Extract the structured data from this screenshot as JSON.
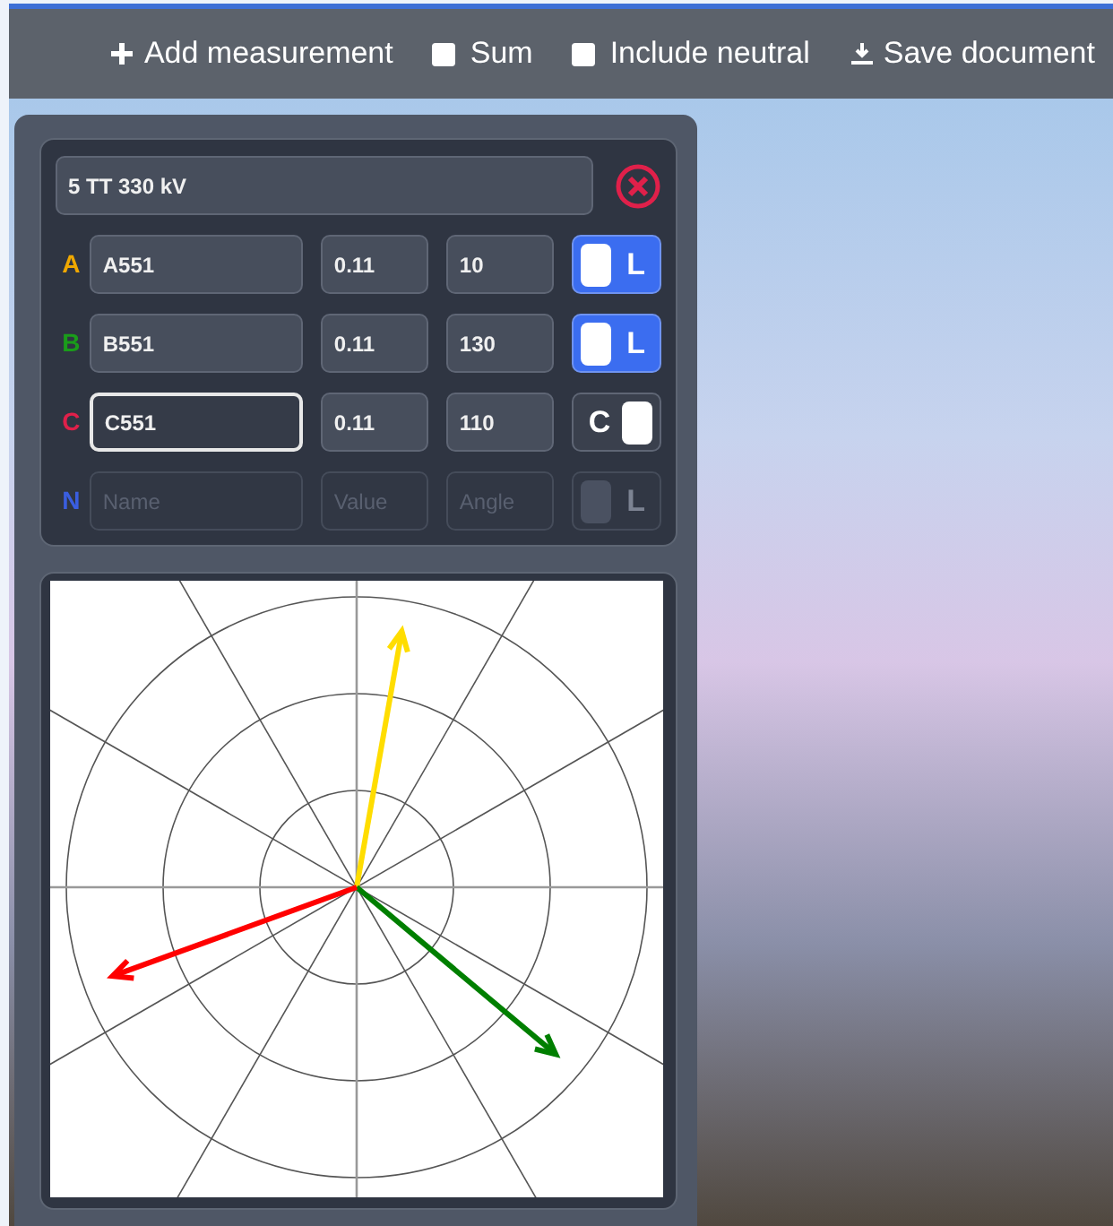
{
  "toolbar": [
    {
      "kind": "add",
      "label": "Add measurement"
    },
    {
      "kind": "checkbox",
      "label": "Sum",
      "checked": false
    },
    {
      "kind": "checkbox",
      "label": "Include neutral",
      "checked": false
    },
    {
      "kind": "save",
      "label": "Save document"
    }
  ],
  "measurement": {
    "title": "5 TT 330 kV",
    "phases": [
      {
        "letter": "A",
        "color": "#f0a800",
        "arrow": {
          "color": "#ffdd00"
        },
        "fields": [
          {
            "kind": "name",
            "value": "A551"
          },
          {
            "kind": "value",
            "value": "0.11"
          },
          {
            "kind": "angle",
            "value": "10"
          }
        ],
        "toggle_label": "L",
        "capacitive": false,
        "focused": false,
        "disabled": false
      },
      {
        "letter": "B",
        "color": "#1a9c1a",
        "arrow": {
          "color": "#007f00"
        },
        "fields": [
          {
            "kind": "name",
            "value": "B551"
          },
          {
            "kind": "value",
            "value": "0.11"
          },
          {
            "kind": "angle",
            "value": "130"
          }
        ],
        "toggle_label": "L",
        "capacitive": false,
        "focused": false,
        "disabled": false
      },
      {
        "letter": "C",
        "color": "#e0204a",
        "arrow": {
          "color": "#ff0000"
        },
        "fields": [
          {
            "kind": "name",
            "value": "C551"
          },
          {
            "kind": "value",
            "value": "0.11"
          },
          {
            "kind": "angle",
            "value": "110"
          }
        ],
        "toggle_label": "C",
        "capacitive": true,
        "focused": true,
        "disabled": false
      },
      {
        "letter": "N",
        "color": "#3a5ee0",
        "fields": [
          {
            "kind": "name",
            "placeholder": "Name"
          },
          {
            "kind": "value",
            "placeholder": "Value"
          },
          {
            "kind": "angle",
            "placeholder": "Angle"
          }
        ],
        "toggle_label": "L",
        "capacitive": false,
        "focused": false,
        "disabled": true
      }
    ]
  }
}
